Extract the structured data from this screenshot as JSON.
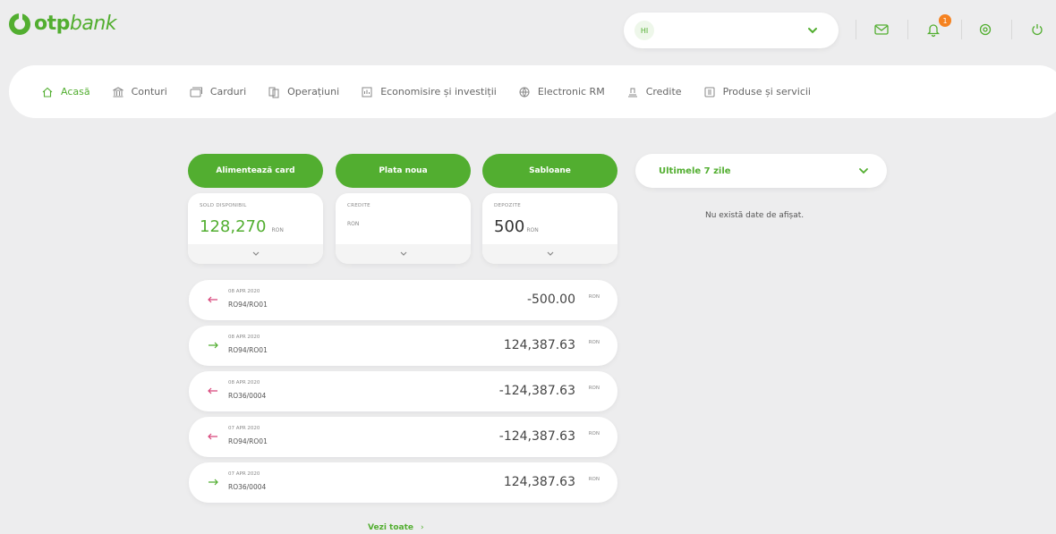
{
  "brand": {
    "logo_bold": "otp",
    "logo_light": "bank",
    "accent": "#52ae30",
    "badge_color": "#f58220"
  },
  "header": {
    "user_initials": "HI",
    "notification_count": "1",
    "icons": [
      "mail-icon",
      "bell-icon",
      "settings-icon",
      "power-icon"
    ]
  },
  "nav": {
    "items": [
      {
        "label": "Acasă",
        "icon": "home-icon",
        "active": true
      },
      {
        "label": "Conturi",
        "icon": "bank-icon"
      },
      {
        "label": "Carduri",
        "icon": "card-icon"
      },
      {
        "label": "Operațiuni",
        "icon": "transfer-icon"
      },
      {
        "label": "Economisire și investiții",
        "icon": "savings-icon"
      },
      {
        "label": "Electronic RM",
        "icon": "globe-icon"
      },
      {
        "label": "Credite",
        "icon": "credit-icon"
      },
      {
        "label": "Produse și servicii",
        "icon": "products-icon"
      }
    ]
  },
  "actions": {
    "top_up_card": "Alimentează card",
    "new_payment": "Plata noua",
    "templates": "Sabloane"
  },
  "summary": {
    "available_balance": {
      "label": "SOLD DISPONIBIL",
      "value": "128,270",
      "currency": "RON"
    },
    "credits": {
      "label": "CREDITE",
      "value": "",
      "currency": "RON"
    },
    "deposits": {
      "label": "DEPOZITE",
      "value": "500",
      "currency": "RON"
    }
  },
  "transactions": [
    {
      "date": "08 APR 2020",
      "account": "RO94/RO01",
      "amount": "-500.00",
      "currency": "RON",
      "direction": "out"
    },
    {
      "date": "08 APR 2020",
      "account": "RO94/RO01",
      "amount": "124,387.63",
      "currency": "RON",
      "direction": "in"
    },
    {
      "date": "08 APR 2020",
      "account": "RO36/0004",
      "amount": "-124,387.63",
      "currency": "RON",
      "direction": "out"
    },
    {
      "date": "07 APR 2020",
      "account": "RO94/RO01",
      "amount": "-124,387.63",
      "currency": "RON",
      "direction": "out"
    },
    {
      "date": "07 APR 2020",
      "account": "RO36/0004",
      "amount": "124,387.63",
      "currency": "RON",
      "direction": "in"
    }
  ],
  "see_all": "Vezi toate",
  "period_select": {
    "value": "Ultimele 7 zile"
  },
  "empty_state": "Nu există date de afișat."
}
